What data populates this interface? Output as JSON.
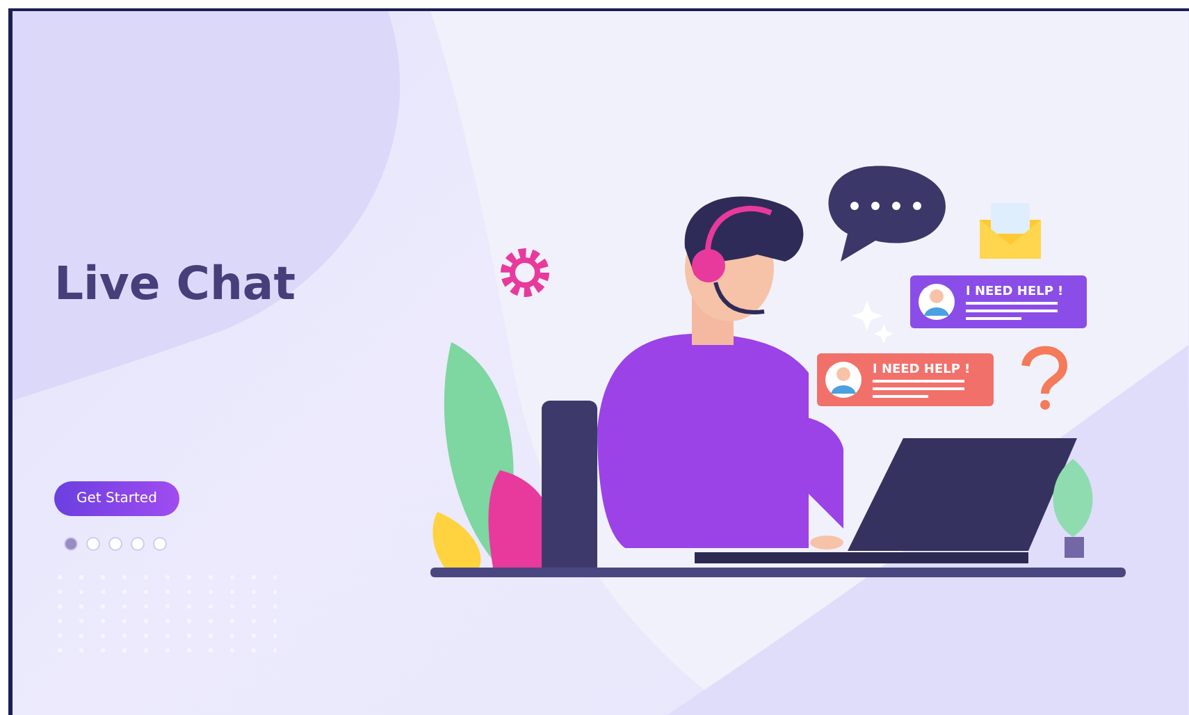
{
  "hero": {
    "title": "Live Chat",
    "button": "Get Started"
  },
  "slides": [
    {
      "selected": true
    },
    {
      "selected": false
    },
    {
      "selected": false
    },
    {
      "selected": false
    },
    {
      "selected": false
    }
  ],
  "chat_cards": [
    {
      "text": "I NEED HELP !",
      "color": "#8a4de8"
    },
    {
      "text": "I NEED HELP !",
      "color": "#f2706a"
    }
  ]
}
